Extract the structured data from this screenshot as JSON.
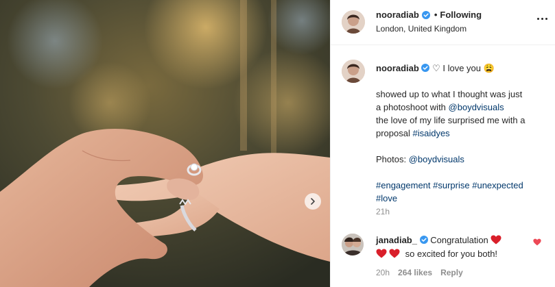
{
  "header": {
    "username": "nooradiab",
    "separator": "•",
    "follow_status": "Following",
    "location": "London, United Kingdom"
  },
  "caption": {
    "username": "nooradiab",
    "first_line": "♡ I love you 😩",
    "lines": [
      "showed up to what I thought was just",
      "a photoshoot with "
    ],
    "mention1": "@boydvisuals",
    "line3": "the love of my life surprised me with a",
    "line4": "proposal ",
    "hashtag_isaidyes": "#isaidyes",
    "photos_label": "Photos: ",
    "mention2": "@boydvisuals",
    "hashtags": [
      "#engagement",
      "#surprise",
      "#unexpected",
      "#love"
    ],
    "time": "21h"
  },
  "comment": {
    "username": "janadiab_",
    "text1": "Congratulation",
    "text2": "so excited for you both!",
    "time": "20h",
    "likes": "264 likes",
    "reply": "Reply"
  },
  "colors": {
    "link": "#00376b",
    "verified": "#3897f0",
    "heart": "#ed4956"
  },
  "icons": {
    "verified": "verified-badge-icon",
    "more": "more-options-icon",
    "next": "chevron-right-icon",
    "heart": "heart-icon"
  }
}
